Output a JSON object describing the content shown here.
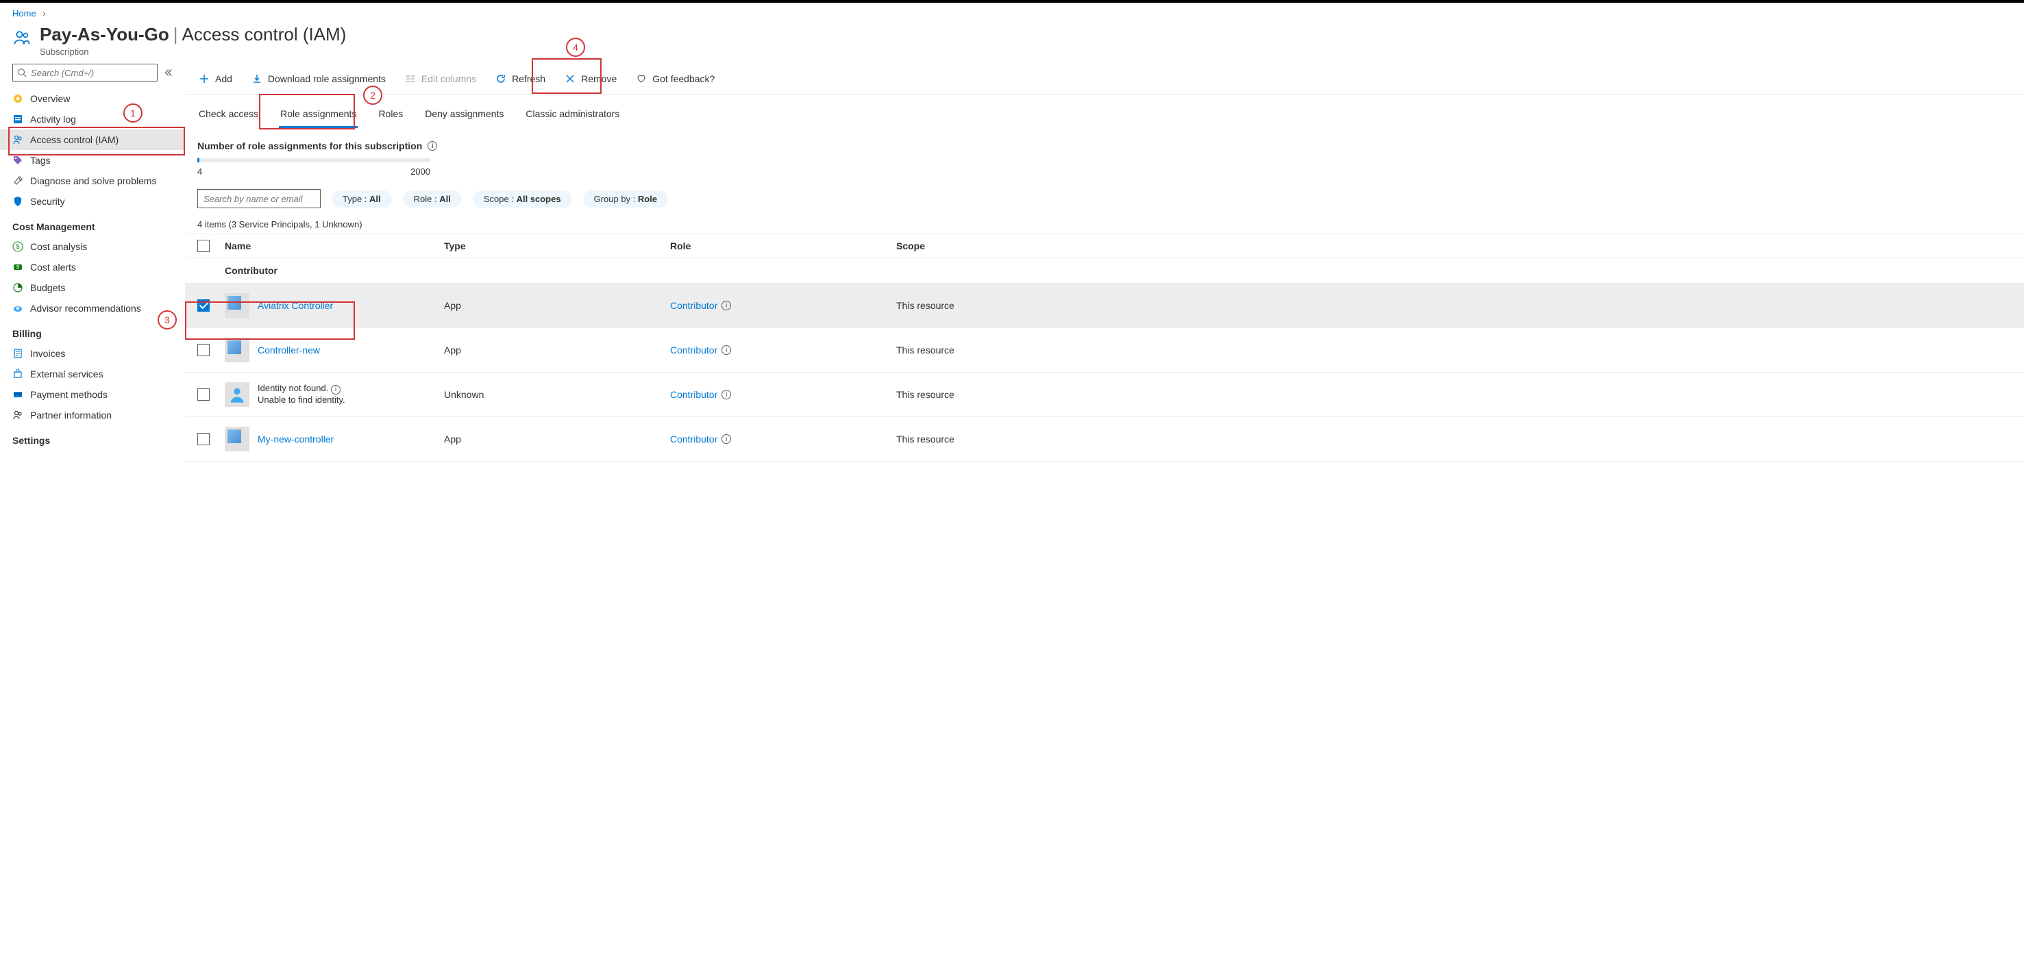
{
  "breadcrumb": {
    "home": "Home"
  },
  "header": {
    "title": "Pay-As-You-Go",
    "subtitle": "Access control (IAM)",
    "label": "Subscription"
  },
  "sidebar": {
    "search_placeholder": "Search (Cmd+/)",
    "items": [
      {
        "label": "Overview"
      },
      {
        "label": "Activity log"
      },
      {
        "label": "Access control (IAM)"
      },
      {
        "label": "Tags"
      },
      {
        "label": "Diagnose and solve problems"
      },
      {
        "label": "Security"
      }
    ],
    "cost_section": "Cost Management",
    "cost_items": [
      {
        "label": "Cost analysis"
      },
      {
        "label": "Cost alerts"
      },
      {
        "label": "Budgets"
      },
      {
        "label": "Advisor recommendations"
      }
    ],
    "billing_section": "Billing",
    "billing_items": [
      {
        "label": "Invoices"
      },
      {
        "label": "External services"
      },
      {
        "label": "Payment methods"
      },
      {
        "label": "Partner information"
      }
    ],
    "settings_section": "Settings"
  },
  "toolbar": {
    "add": "Add",
    "download": "Download role assignments",
    "edit_columns": "Edit columns",
    "refresh": "Refresh",
    "remove": "Remove",
    "feedback": "Got feedback?"
  },
  "tabs": {
    "check_access": "Check access",
    "role_assignments": "Role assignments",
    "roles": "Roles",
    "deny_assignments": "Deny assignments",
    "classic_admins": "Classic administrators"
  },
  "usage": {
    "title": "Number of role assignments for this subscription",
    "current": "4",
    "max": "2000"
  },
  "filters": {
    "search_placeholder": "Search by name or email",
    "type_label": "Type : ",
    "type_value": "All",
    "role_label": "Role : ",
    "role_value": "All",
    "scope_label": "Scope : ",
    "scope_value": "All scopes",
    "group_label": "Group by : ",
    "group_value": "Role"
  },
  "summary": "4 items (3 Service Principals, 1 Unknown)",
  "columns": {
    "name": "Name",
    "type": "Type",
    "role": "Role",
    "scope": "Scope"
  },
  "group": "Contributor",
  "rows": [
    {
      "name": "Aviatrix Controller",
      "type": "App",
      "role": "Contributor",
      "scope": "This resource",
      "kind": "app",
      "checked": true
    },
    {
      "name": "Controller-new",
      "type": "App",
      "role": "Contributor",
      "scope": "This resource",
      "kind": "app",
      "checked": false
    },
    {
      "name_line1": "Identity not found.",
      "name_line2": "Unable to find identity.",
      "type": "Unknown",
      "role": "Contributor",
      "scope": "This resource",
      "kind": "user",
      "checked": false
    },
    {
      "name": "My-new-controller",
      "type": "App",
      "role": "Contributor",
      "scope": "This resource",
      "kind": "app",
      "checked": false
    }
  ],
  "annotations": {
    "a1": "1",
    "a2": "2",
    "a3": "3",
    "a4": "4"
  }
}
